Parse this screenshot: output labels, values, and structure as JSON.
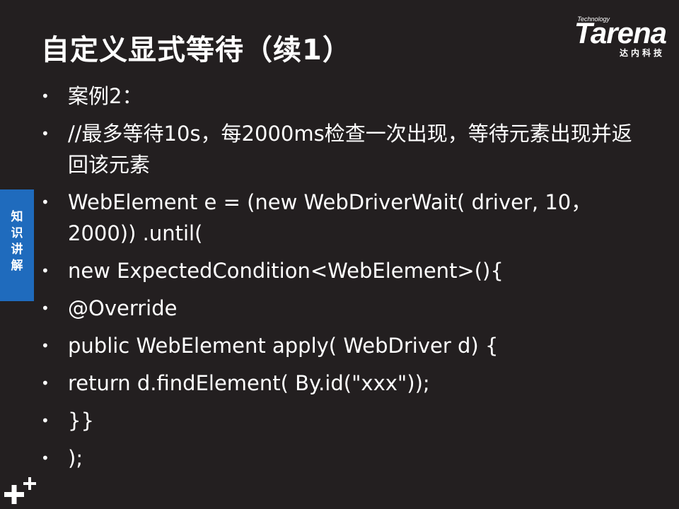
{
  "slide": {
    "title": "自定义显式等待（续1）",
    "side_tab_label": "知识讲解",
    "bullets": [
      "案例2：",
      "//最多等待10s，每2000ms检查一次出现，等待元素出现并返回该元素",
      "WebElement e = (new WebDriverWait( driver, 10，2000)) .until(",
      "new ExpectedCondition<WebElement>(){",
      "@Override",
      "public WebElement apply( WebDriver d) {",
      "return d.findElement( By.id(\"xxx\"));",
      "}}",
      ");"
    ]
  },
  "logo": {
    "technology": "Technology",
    "brand": "Tarena",
    "cn": "达内科技"
  },
  "colors": {
    "background": "#231f20",
    "side_tab": "#1f6bbd",
    "text": "#ffffff"
  },
  "icons": {
    "corner": "plus-icon"
  }
}
